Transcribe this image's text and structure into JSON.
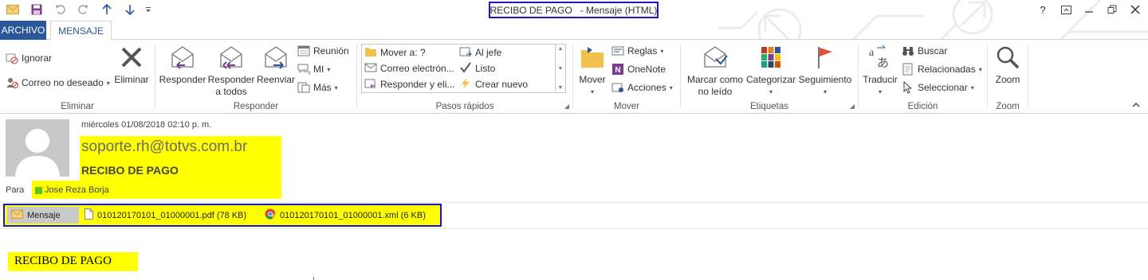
{
  "window": {
    "title": "RECIBO DE PAGO   - Mensaje (HTML)",
    "help_label": "?"
  },
  "icons": {
    "qat": [
      "envelope-icon",
      "save-icon",
      "undo-icon",
      "redo-icon",
      "previous-item-icon",
      "next-item-icon",
      "customize-qat-icon"
    ],
    "window_controls": [
      "help-icon",
      "ribbon-display-icon",
      "minimize-icon",
      "restore-icon",
      "close-icon"
    ]
  },
  "tabs": {
    "archivo": "ARCHIVO",
    "mensaje": "MENSAJE"
  },
  "ribbon": {
    "eliminar": {
      "label": "Eliminar",
      "ignorar": "Ignorar",
      "correo_no_deseado": "Correo no deseado",
      "eliminar_btn": "Eliminar"
    },
    "responder": {
      "label": "Responder",
      "responder_btn": "Responder",
      "responder_todos_l1": "Responder",
      "responder_todos_l2": "a todos",
      "reenviar": "Reenviar",
      "reunion": "Reunión",
      "mi": "MI",
      "mas": "Más"
    },
    "pasos_rapidos": {
      "label": "Pasos rápidos",
      "items": [
        "Mover a: ?",
        "Al jefe",
        "Correo electrón...",
        "Listo",
        "Responder y eli...",
        "Crear nuevo"
      ]
    },
    "mover": {
      "label": "Mover",
      "mover_btn": "Mover",
      "reglas": "Reglas",
      "onenote": "OneNote",
      "acciones": "Acciones"
    },
    "etiquetas": {
      "label": "Etiquetas",
      "marcar_l1": "Marcar como",
      "marcar_l2": "no leído",
      "categorizar": "Categorizar",
      "seguimiento": "Seguimiento"
    },
    "edicion": {
      "label": "Edición",
      "traducir": "Traducir",
      "buscar": "Buscar",
      "relacionadas": "Relacionadas",
      "seleccionar": "Seleccionar"
    },
    "zoom": {
      "label": "Zoom",
      "zoom_btn": "Zoom"
    }
  },
  "message": {
    "date": "miércoles 01/08/2018 02:10 p. m.",
    "sender": "soporte.rh@totvs.com.br",
    "subject": "RECIBO DE PAGO",
    "to_label": "Para",
    "recipient": "Jose Reza Borja"
  },
  "attachments": {
    "message_tab": "Mensaje",
    "items": [
      {
        "name": "010120170101_01000001.pdf (78 KB)",
        "icon": "pdf-file-icon"
      },
      {
        "name": "010120170101_01000001.xml (6 KB)",
        "icon": "chrome-icon"
      }
    ]
  },
  "body": {
    "text": "RECIBO DE PAGO"
  },
  "colors": {
    "accent": "#2b579a",
    "highlight": "#ffff00",
    "annotation_border": "#1a1ac4",
    "presence": "#5dc21e"
  }
}
